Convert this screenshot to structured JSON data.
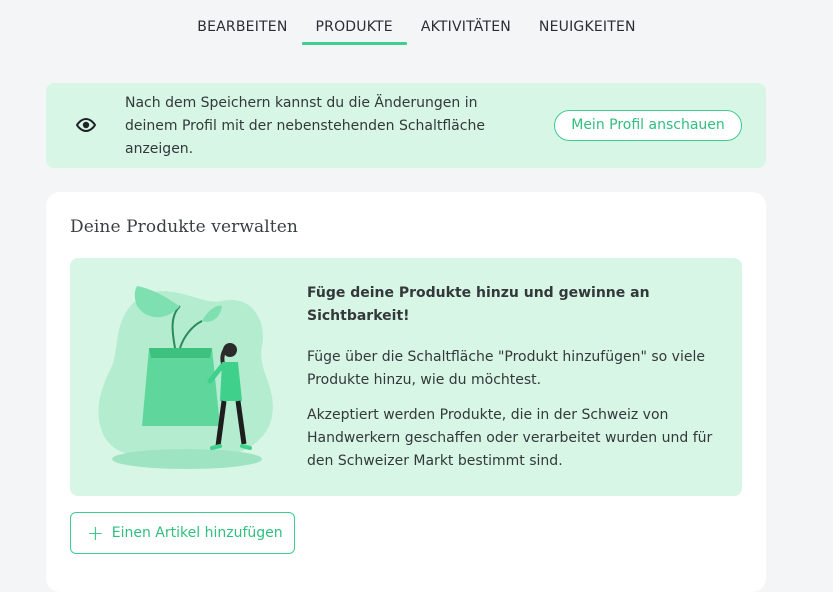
{
  "tabs": [
    {
      "label": "BEARBEITEN",
      "active": false
    },
    {
      "label": "PRODUKTE",
      "active": true
    },
    {
      "label": "AKTIVITÄTEN",
      "active": false
    },
    {
      "label": "NEUIGKEITEN",
      "active": false
    }
  ],
  "info_banner": {
    "icon": "eye-icon",
    "text": "Nach dem Speichern kannst du die Änderungen in deinem Profil mit der nebenstehenden Schaltfläche anzeigen.",
    "button_label": "Mein Profil anschauen"
  },
  "products_card": {
    "title": "Deine Produkte verwalten",
    "promo": {
      "heading": "Füge deine Produkte hinzu und gewinne an Sichtbarkeit!",
      "paragraph_1": "Füge über die Schaltfläche \"Produkt hinzufügen\" so viele Produkte hinzu, wie du möchtest.",
      "paragraph_2": "Akzeptiert werden Produkte, die in der Schweiz von Handwerkern geschaffen oder verarbeitet wurden und für den Schweizer Markt bestimmt sind."
    },
    "add_button_label": "Einen Artikel hinzufügen",
    "add_button_icon": "plus-icon"
  },
  "colors": {
    "accent": "#3dcf8d",
    "banner_bg": "#d8f6e6",
    "page_bg": "#f4f5f7"
  }
}
